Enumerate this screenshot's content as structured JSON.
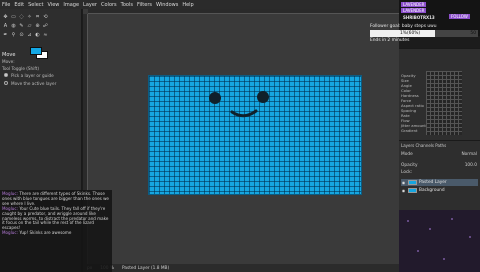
{
  "menu": [
    "File",
    "Edit",
    "Select",
    "View",
    "Image",
    "Layer",
    "Colors",
    "Tools",
    "Filters",
    "Windows",
    "Help"
  ],
  "tool_options": {
    "title": "Move",
    "move_label": "Move:",
    "toggle_label": "Tool Toggle  (Shift)",
    "opt1": "Pick a layer or guide",
    "opt2": "Move the active layer"
  },
  "chat": [
    {
      "user": "Mogluc:",
      "text": "There are different types of Skinks. Those ones with blue tongues are bigger than the ones we see where I live."
    },
    {
      "user": "Mogluc:",
      "text": "Your Cute blue tails. They fall off if they're caught by a predator, and wriggle around like nameless worms, to distract the predator and make it focus on the tail while the rest of the lizard escapes!"
    },
    {
      "user": "Mogluc:",
      "text": "Yup! Skinks are awesome"
    }
  ],
  "status": {
    "unit": "px",
    "zoom": "100 %",
    "layer_info": "Pasted Layer (1.8 MB)"
  },
  "twitch": {
    "tags": [
      "LAVENDER",
      "LAVENDER",
      "FOLLOW"
    ],
    "username": "SHRIBOTRX13",
    "follower_goal": "Follower goal: baby steps uwu",
    "follower_pct_text": "1%(60%)",
    "follower_pct": 0.6,
    "follower_count": "50",
    "ends": "Ends in 2 minutes"
  },
  "dynamics": {
    "labels": [
      "Opacity",
      "Size",
      "Angle",
      "Color",
      "Hardness",
      "Force",
      "Aspect ratio",
      "Spacing",
      "Rate",
      "Flow",
      "Jitter amount",
      "Gradient"
    ]
  },
  "layers_panel": {
    "tabs": "Layers  Channels  Paths",
    "mode_label": "Mode",
    "mode_value": "Normal",
    "opacity_label": "Opacity",
    "opacity_value": "100.0",
    "lock_label": "Lock:",
    "layers": [
      {
        "name": "Pasted Layer"
      },
      {
        "name": "Background"
      }
    ]
  },
  "colors": {
    "canvas_fill": "#16a6e0",
    "fg_color": "#13a8e6",
    "bg_color": "#ffffff",
    "face": "#10202a"
  }
}
